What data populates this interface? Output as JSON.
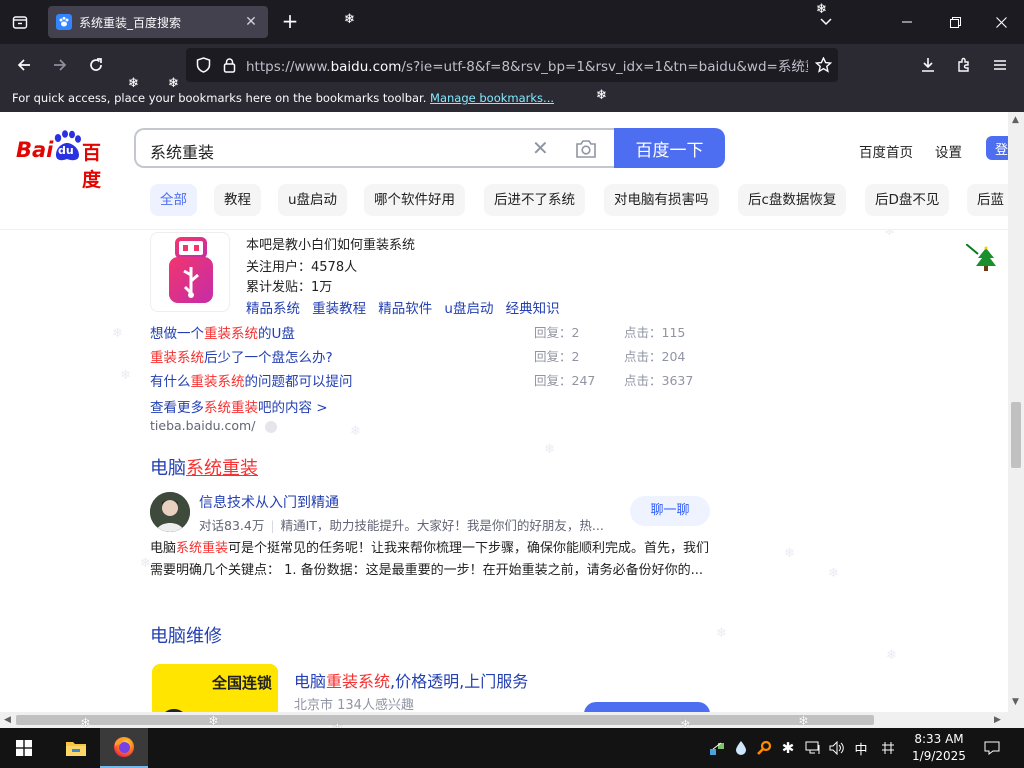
{
  "browser": {
    "tab_title": "系统重装_百度搜索",
    "url_prefix": "https://www.",
    "url_domain": "baidu.com",
    "url_rest": "/s?ie=utf-8&f=8&rsv_bp=1&rsv_idx=1&tn=baidu&wd=系统重装&",
    "bookmarks_text": "For quick access, place your bookmarks here on the bookmarks toolbar. ",
    "bookmarks_link": "Manage bookmarks..."
  },
  "baidu": {
    "logo_bai": "Bai",
    "logo_du": "du",
    "logo_cn": "百度",
    "query": "系统重装",
    "search_button": "百度一下",
    "home_link": "百度首页",
    "settings_link": "设置",
    "login": "登",
    "chips": [
      "全部",
      "教程",
      "u盘启动",
      "哪个软件好用",
      "后进不了系统",
      "对电脑有损害吗",
      "后c盘数据恢复",
      "后D盘不见",
      "后蓝"
    ]
  },
  "tieba": {
    "intro": "本吧是教小白们如何重装系统",
    "followers": "关注用户：4578人",
    "posts": "累计发贴：1万",
    "categories": [
      "精品系统",
      "重装教程",
      "精品软件",
      "u盘启动",
      "经典知识"
    ],
    "threads": [
      {
        "pre": "想做一个",
        "hl": "重装系统",
        "post": "的U盘",
        "replies": "回复：2",
        "clicks": "点击：115"
      },
      {
        "pre": "",
        "hl": "重装系统",
        "post": "后少了一个盘怎么办?",
        "replies": "回复：2",
        "clicks": "点击：204"
      },
      {
        "pre": "有什么",
        "hl": "重装系统",
        "post": "的问题都可以提问",
        "replies": "回复：247",
        "clicks": "点击：3637"
      }
    ],
    "more_pre": "查看更多",
    "more_hl": "系统重装",
    "more_post": "吧的内容 >",
    "source": "tieba.baidu.com/"
  },
  "result2": {
    "title_pre": "电脑",
    "title_hl": "系统重装",
    "author": "信息技术从入门到精通",
    "stats": "对话83.4万",
    "bio": "精通IT，助力技能提升。大家好！我是你们的好朋友，热...",
    "chat_button": "聊一聊",
    "para1_pre": "电脑",
    "para1_hl": "系统重装",
    "para1_post": "可是个挺常见的任务呢！让我来帮你梳理一下步骤，确保你能顺利完成。首先，我们",
    "para2": "需要明确几个关键点： 1. 备份数据：这是最重要的一步！在开始重装之前，请务必备份好你的..."
  },
  "result3": {
    "title": "电脑维修",
    "card_tag": "全国连锁",
    "ad_title_pre": "电脑",
    "ad_title_hl": "重装系统",
    "ad_title_post": ",价格透明,上门服务",
    "ad_meta": "北京市 134人感兴趣"
  },
  "taskbar": {
    "ime": "中",
    "time": "8:33 AM",
    "date": "1/9/2025"
  },
  "colors": {
    "accent": "#4e6ef2",
    "link": "#2440b3",
    "highlight": "#f73131"
  }
}
